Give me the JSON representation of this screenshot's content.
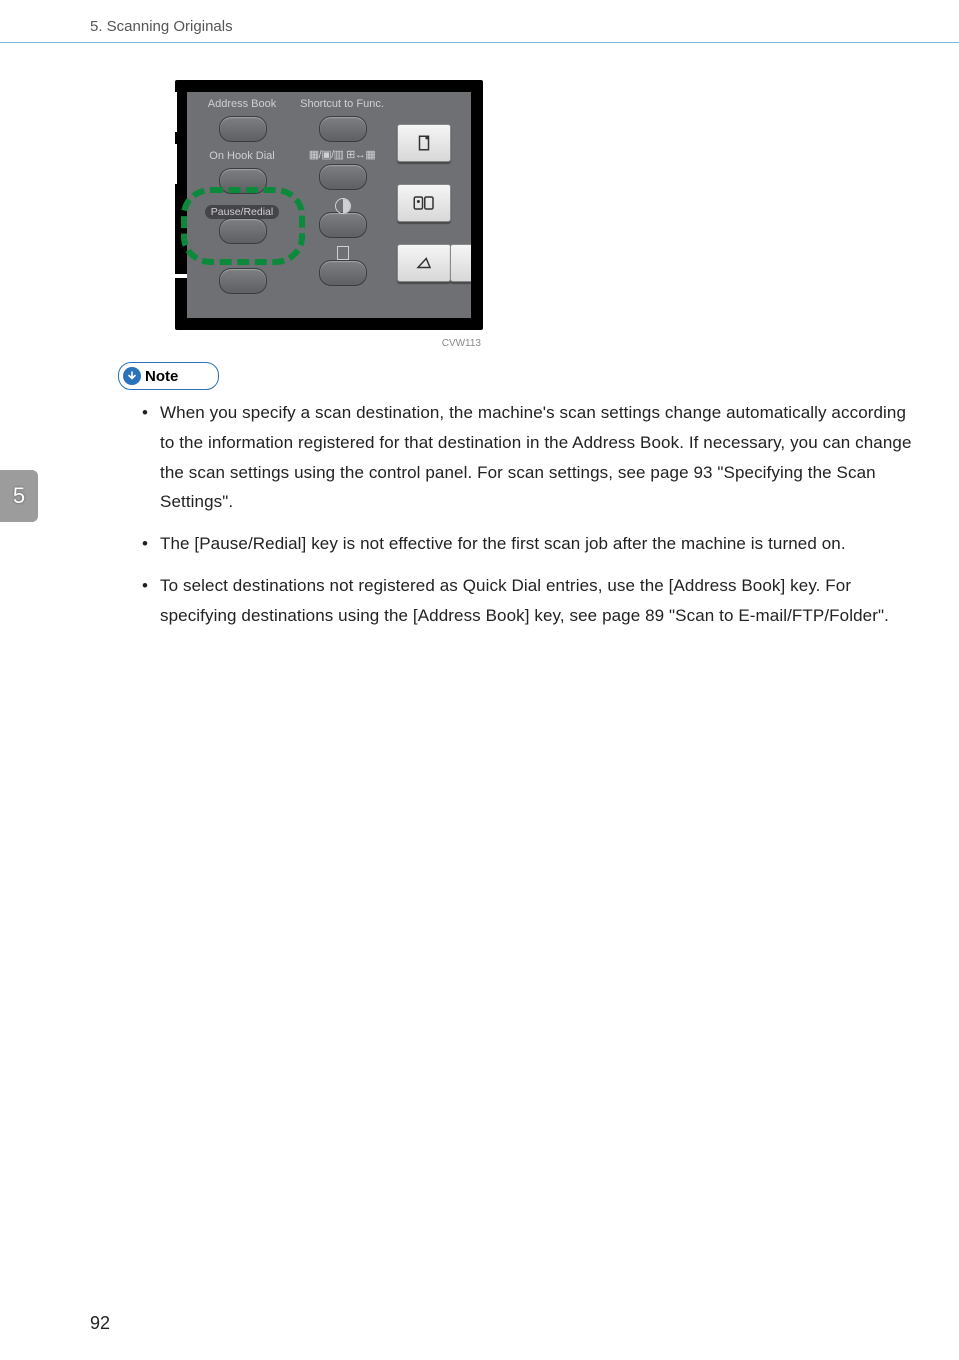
{
  "header": {
    "running_head": "5. Scanning Originals"
  },
  "chapter_tab": "5",
  "page_number": "92",
  "figure": {
    "id": "CVW113",
    "left_col": {
      "addr": "Address Book",
      "onhook": "On Hook Dial",
      "pause": "Pause/Redial"
    },
    "mid_col": {
      "shortcut": "Shortcut to Func.",
      "row2_icons": "▦/▣/▥ ⊞↔▦"
    }
  },
  "note_label": "Note",
  "notes": [
    "When you specify a scan destination, the machine's scan settings change automatically according to the information registered for that destination in the Address Book. If necessary, you can change the scan settings using the control panel. For scan settings, see page 93 \"Specifying the Scan Settings\".",
    "The [Pause/Redial] key is not effective for the first scan job after the machine is turned on.",
    "To select destinations not registered as Quick Dial entries, use the [Address Book] key. For specifying destinations using the [Address Book] key, see page 89 \"Scan to E-mail/FTP/Folder\"."
  ]
}
